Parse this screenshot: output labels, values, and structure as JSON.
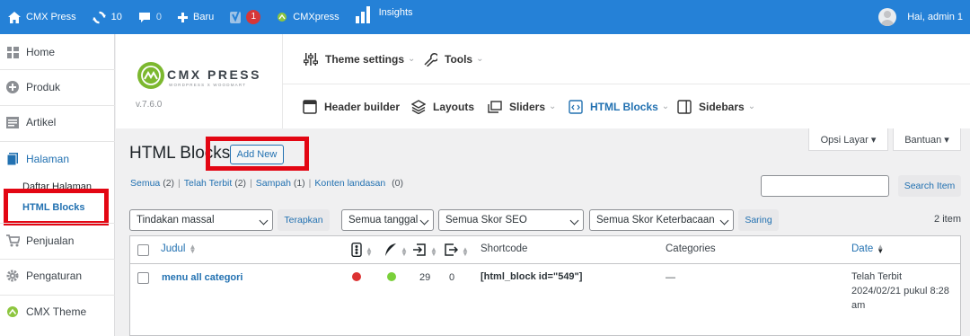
{
  "colors": {
    "adminbar": "#2581d7",
    "accent": "#2271b1",
    "highlight": "#e30613",
    "seo_bad": "#dc3232",
    "readability_good": "#7ad03a"
  },
  "adminbar": {
    "site_name": "CMX Press",
    "updates_count": "10",
    "comments_count": "0",
    "new_label": "Baru",
    "yoast_badge": "1",
    "cmxpress_label": "CMXpress",
    "insights_label": "Insights",
    "greeting": "Hai, admin 1"
  },
  "sidebar": {
    "items": [
      {
        "label": "Home",
        "icon": "dashboard-icon"
      },
      {
        "label": "Produk",
        "icon": "plus-circle-icon"
      },
      {
        "label": "Artikel",
        "icon": "posts-icon"
      },
      {
        "label": "Halaman",
        "icon": "pages-icon"
      },
      {
        "label": "Penjualan",
        "icon": "cart-icon"
      },
      {
        "label": "Pengaturan",
        "icon": "gear-icon"
      },
      {
        "label": "CMX Theme",
        "icon": "cmx-logo-icon"
      }
    ],
    "submenu": [
      "Daftar Halaman",
      "HTML Blocks"
    ]
  },
  "theme_header": {
    "brand_name": "CMX PRESS",
    "brand_tagline": "WORDPRESS X WOODMART",
    "version": "v.7.6.0",
    "top_nav": [
      "Theme settings",
      "Tools"
    ],
    "bottom_nav": [
      "Header builder",
      "Layouts",
      "Sliders",
      "HTML Blocks",
      "Sidebars"
    ]
  },
  "screen_options": {
    "options_label": "Opsi Layar ▾",
    "help_label": "Bantuan ▾"
  },
  "page": {
    "title": "HTML Blocks",
    "add_new": "Add New"
  },
  "filters_views": {
    "all": "Semua",
    "all_count": "(2)",
    "published": "Telah Terbit",
    "published_count": "(2)",
    "trash": "Sampah",
    "trash_count": "(1)",
    "cornerstone": "Konten landasan",
    "cornerstone_count": "(0)"
  },
  "search": {
    "button": "Search Item",
    "value": ""
  },
  "tablenav": {
    "bulk_action": "Tindakan massal",
    "apply": "Terapkan",
    "date_filter": "Semua tanggal",
    "seo_filter": "Semua Skor SEO",
    "readability_filter": "Semua Skor Keterbacaan",
    "filter_button": "Saring",
    "items_count": "2 item"
  },
  "table": {
    "columns": {
      "title": "Judul",
      "shortcode": "Shortcode",
      "categories": "Categories",
      "date": "Date"
    },
    "rows": [
      {
        "title": "menu all categori",
        "seo": "bad",
        "readability": "good",
        "incoming_links": "29",
        "outgoing_links": "0",
        "shortcode": "[html_block id=\"549\"]",
        "categories": "—",
        "date_status": "Telah Terbit",
        "date_value": "2024/02/21 pukul 8:28",
        "date_suffix": "am"
      }
    ]
  }
}
